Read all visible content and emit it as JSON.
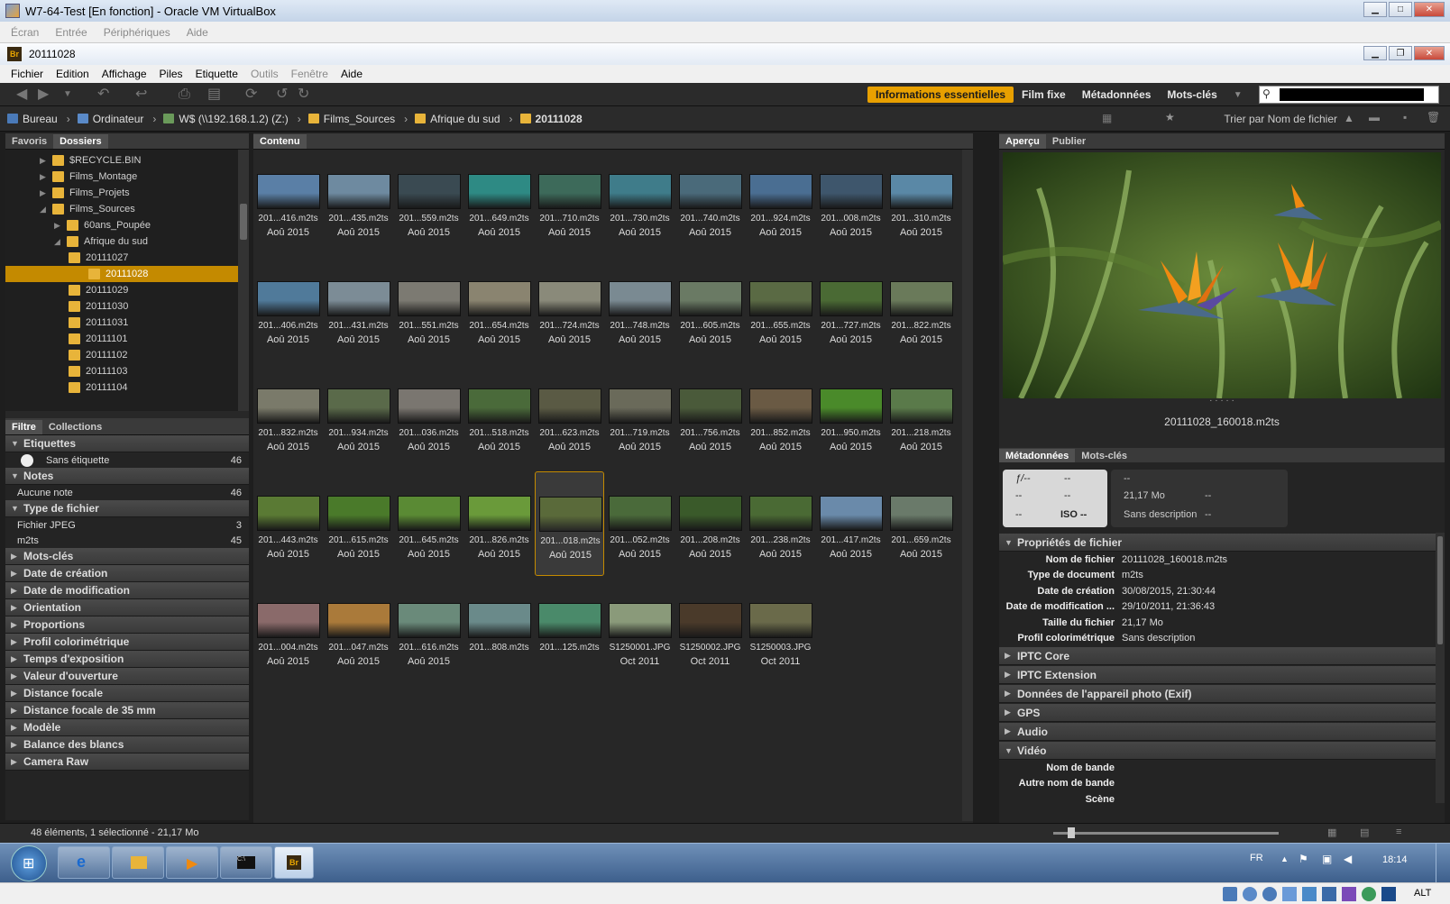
{
  "vbox": {
    "title": "W7-64-Test [En fonction] - Oracle VM VirtualBox",
    "menu": [
      "Écran",
      "Entrée",
      "Périphériques",
      "Aide"
    ],
    "status_right": "ALT"
  },
  "bridge": {
    "window_title": "20111028",
    "menu": [
      "Fichier",
      "Edition",
      "Affichage",
      "Piles",
      "Etiquette",
      "Outils",
      "Fenêtre",
      "Aide"
    ],
    "workspaces": [
      "Informations essentielles",
      "Film fixe",
      "Métadonnées",
      "Mots-clés"
    ],
    "active_workspace": "Informations essentielles",
    "path": [
      "Bureau",
      "Ordinateur",
      "W$ (\\\\192.168.1.2) (Z:)",
      "Films_Sources",
      "Afrique du sud",
      "20111028"
    ],
    "sort_label": "Trier par Nom de fichier"
  },
  "left": {
    "tabs": [
      "Favoris",
      "Dossiers"
    ],
    "tree": [
      {
        "label": "$RECYCLE.BIN",
        "level": 1
      },
      {
        "label": "Films_Montage",
        "level": 1
      },
      {
        "label": "Films_Projets",
        "level": 1
      },
      {
        "label": "Films_Sources",
        "level": 1
      },
      {
        "label": "60ans_Poupée",
        "level": 2
      },
      {
        "label": "Afrique du sud",
        "level": 2
      },
      {
        "label": "20111027",
        "level": 3
      },
      {
        "label": "20111028",
        "level": 3,
        "selected": true
      },
      {
        "label": "20111029",
        "level": 3
      },
      {
        "label": "20111030",
        "level": 3
      },
      {
        "label": "20111031",
        "level": 3
      },
      {
        "label": "20111101",
        "level": 3
      },
      {
        "label": "20111102",
        "level": 3
      },
      {
        "label": "20111103",
        "level": 3
      },
      {
        "label": "20111104",
        "level": 3
      }
    ],
    "filter_tabs": [
      "Filtre",
      "Collections"
    ],
    "filters": [
      {
        "head": "Etiquettes",
        "open": true,
        "rows": [
          {
            "label": "Sans étiquette",
            "count": "46"
          }
        ]
      },
      {
        "head": "Notes",
        "open": true,
        "rows": [
          {
            "label": "Aucune note",
            "count": "46"
          }
        ]
      },
      {
        "head": "Type de fichier",
        "open": true,
        "rows": [
          {
            "label": "Fichier JPEG",
            "count": "3"
          },
          {
            "label": "m2ts",
            "count": "45"
          }
        ]
      },
      {
        "head": "Mots-clés"
      },
      {
        "head": "Date de création"
      },
      {
        "head": "Date de modification"
      },
      {
        "head": "Orientation"
      },
      {
        "head": "Proportions"
      },
      {
        "head": "Profil colorimétrique"
      },
      {
        "head": "Temps d'exposition"
      },
      {
        "head": "Valeur d'ouverture"
      },
      {
        "head": "Distance focale"
      },
      {
        "head": "Distance focale de 35 mm"
      },
      {
        "head": "Modèle"
      },
      {
        "head": "Balance des blancs"
      },
      {
        "head": "Camera Raw"
      }
    ]
  },
  "content": {
    "tab": "Contenu",
    "items": [
      {
        "n": "201...416.m2ts",
        "d": "Aoû 2015",
        "c": "#5a7fa6"
      },
      {
        "n": "201...435.m2ts",
        "d": "Aoû 2015",
        "c": "#6e8aa0"
      },
      {
        "n": "201...559.m2ts",
        "d": "Aoû 2015",
        "c": "#3a4a52"
      },
      {
        "n": "201...649.m2ts",
        "d": "Aoû 2015",
        "c": "#2e8a84"
      },
      {
        "n": "201...710.m2ts",
        "d": "Aoû 2015",
        "c": "#3d6a5a"
      },
      {
        "n": "201...730.m2ts",
        "d": "Aoû 2015",
        "c": "#3f7c8a"
      },
      {
        "n": "201...740.m2ts",
        "d": "Aoû 2015",
        "c": "#4a6a7a"
      },
      {
        "n": "201...924.m2ts",
        "d": "Aoû 2015",
        "c": "#4a6e92"
      },
      {
        "n": "201...008.m2ts",
        "d": "Aoû 2015",
        "c": "#3e566c"
      },
      {
        "n": "201...310.m2ts",
        "d": "Aoû 2015",
        "c": "#5a88a6"
      },
      {
        "n": "201...406.m2ts",
        "d": "Aoû 2015",
        "c": "#507a9a"
      },
      {
        "n": "201...431.m2ts",
        "d": "Aoû 2015",
        "c": "#7c8c96"
      },
      {
        "n": "201...551.m2ts",
        "d": "Aoû 2015",
        "c": "#7c7a72"
      },
      {
        "n": "201...654.m2ts",
        "d": "Aoû 2015",
        "c": "#8a8470"
      },
      {
        "n": "201...724.m2ts",
        "d": "Aoû 2015",
        "c": "#8a8a7a"
      },
      {
        "n": "201...748.m2ts",
        "d": "Aoû 2015",
        "c": "#7a8a92"
      },
      {
        "n": "201...605.m2ts",
        "d": "Aoû 2015",
        "c": "#6a7a64"
      },
      {
        "n": "201...655.m2ts",
        "d": "Aoû 2015",
        "c": "#5a6a44"
      },
      {
        "n": "201...727.m2ts",
        "d": "Aoû 2015",
        "c": "#4a6a34"
      },
      {
        "n": "201...822.m2ts",
        "d": "Aoû 2015",
        "c": "#6a7a5a"
      },
      {
        "n": "201...832.m2ts",
        "d": "Aoû 2015",
        "c": "#7a7a6a"
      },
      {
        "n": "201...934.m2ts",
        "d": "Aoû 2015",
        "c": "#5a6a4a"
      },
      {
        "n": "201...036.m2ts",
        "d": "Aoû 2015",
        "c": "#7a7670"
      },
      {
        "n": "201...518.m2ts",
        "d": "Aoû 2015",
        "c": "#4a6a3a"
      },
      {
        "n": "201...623.m2ts",
        "d": "Aoû 2015",
        "c": "#5a5a44"
      },
      {
        "n": "201...719.m2ts",
        "d": "Aoû 2015",
        "c": "#6a6a5a"
      },
      {
        "n": "201...756.m2ts",
        "d": "Aoû 2015",
        "c": "#4a5a3a"
      },
      {
        "n": "201...852.m2ts",
        "d": "Aoû 2015",
        "c": "#6a5a44"
      },
      {
        "n": "201...950.m2ts",
        "d": "Aoû 2015",
        "c": "#4a8a2a"
      },
      {
        "n": "201...218.m2ts",
        "d": "Aoû 2015",
        "c": "#5a7a4a"
      },
      {
        "n": "201...443.m2ts",
        "d": "Aoû 2015",
        "c": "#5a7a34"
      },
      {
        "n": "201...615.m2ts",
        "d": "Aoû 2015",
        "c": "#4a7a2a"
      },
      {
        "n": "201...645.m2ts",
        "d": "Aoû 2015",
        "c": "#5a8a34"
      },
      {
        "n": "201...826.m2ts",
        "d": "Aoû 2015",
        "c": "#6a9a3a"
      },
      {
        "n": "201...018.m2ts",
        "d": "Aoû 2015",
        "c": "#5a6a3a",
        "sel": true
      },
      {
        "n": "201...052.m2ts",
        "d": "Aoû 2015",
        "c": "#4a6a3a"
      },
      {
        "n": "201...208.m2ts",
        "d": "Aoû 2015",
        "c": "#3a5a2a"
      },
      {
        "n": "201...238.m2ts",
        "d": "Aoû 2015",
        "c": "#4a6a34"
      },
      {
        "n": "201...417.m2ts",
        "d": "Aoû 2015",
        "c": "#6a8aaa"
      },
      {
        "n": "201...659.m2ts",
        "d": "Aoû 2015",
        "c": "#6a7a6a"
      },
      {
        "n": "201...004.m2ts",
        "d": "Aoû 2015",
        "c": "#8a6a6a"
      },
      {
        "n": "201...047.m2ts",
        "d": "Aoû 2015",
        "c": "#aa7a3a"
      },
      {
        "n": "201...616.m2ts",
        "d": "Aoû 2015",
        "c": "#6a8a7a"
      },
      {
        "n": "201...808.m2ts",
        "d": "",
        "c": "#6a8a8a"
      },
      {
        "n": "201...125.m2ts",
        "d": "",
        "c": "#4a8a6a"
      },
      {
        "n": "S1250001.JPG",
        "d": "Oct 2011",
        "c": "#8a9a7a"
      },
      {
        "n": "S1250002.JPG",
        "d": "Oct 2011",
        "c": "#4a3a2a"
      },
      {
        "n": "S1250003.JPG",
        "d": "Oct 2011",
        "c": "#6a6a4a"
      }
    ]
  },
  "right": {
    "tabs": [
      "Aperçu",
      "Publier"
    ],
    "preview_name": "20111028_160018.m2ts",
    "meta_tabs": [
      "Métadonnées",
      "Mots-clés"
    ],
    "camera": {
      "aperture": "ƒ/--",
      "a2": "--",
      "a3": "--",
      "a4": "--",
      "a5": "--",
      "iso": "ISO --"
    },
    "summary": {
      "s1": "--",
      "size": "21,17 Mo",
      "s2": "--",
      "desc": "Sans description",
      "s3": "--"
    },
    "file_props_head": "Propriétés de fichier",
    "file_props": [
      {
        "k": "Nom de fichier",
        "v": "20111028_160018.m2ts"
      },
      {
        "k": "Type de document",
        "v": "m2ts"
      },
      {
        "k": "Date de création",
        "v": "30/08/2015, 21:30:44"
      },
      {
        "k": "Date de modification ...",
        "v": "29/10/2011, 21:36:43"
      },
      {
        "k": "Taille du fichier",
        "v": "21,17 Mo"
      },
      {
        "k": "Profil colorimétrique",
        "v": "Sans description"
      }
    ],
    "groups": [
      "IPTC Core",
      "IPTC Extension",
      "Données de l'appareil photo (Exif)",
      "GPS",
      "Audio"
    ],
    "video_head": "Vidéo",
    "video": [
      {
        "k": "Nom de bande",
        "v": ""
      },
      {
        "k": "Autre nom de bande",
        "v": ""
      },
      {
        "k": "Scène",
        "v": ""
      }
    ]
  },
  "status": "48 éléments, 1 sélectionné - 21,17 Mo",
  "taskbar": {
    "lang": "FR",
    "clock": "18:14"
  }
}
